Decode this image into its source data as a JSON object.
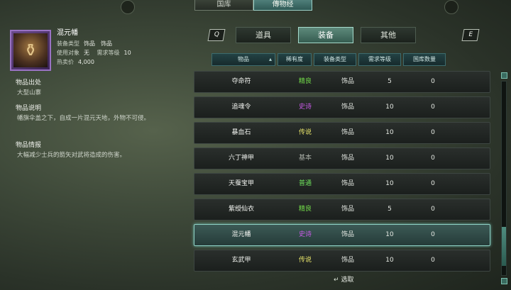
{
  "top_tabs": [
    {
      "label": "国库",
      "active": false
    },
    {
      "label": "傳物经",
      "active": true
    }
  ],
  "selected_item": {
    "name": "混元幡",
    "icon": "banner-relic-icon",
    "equip_type_label": "装备类型",
    "equip_type_value": "饰品",
    "equip_type_value2": "饰品",
    "target_label": "使用对象",
    "target_value": "无",
    "req_level_label": "需求等级",
    "req_level_value": "10",
    "price_label": "热卖价",
    "price_value": "4,000"
  },
  "sections": [
    {
      "title": "物品出处",
      "body": "大型山寨"
    },
    {
      "title": "物品说明",
      "body": "幡旗伞盖之下，自成一片混元天地，外物不可侵。"
    },
    {
      "title": "物品情报",
      "body": "大幅减少士兵的箭矢对武将造成的伤害。"
    }
  ],
  "category_tabs": [
    {
      "label": "道具",
      "active": false
    },
    {
      "label": "装备",
      "active": true
    },
    {
      "label": "其他",
      "active": false
    }
  ],
  "keys": {
    "left": "Q",
    "right": "E"
  },
  "headers": [
    "物品",
    "稀有度",
    "装备类型",
    "需求等级",
    "国库数量"
  ],
  "rows": [
    {
      "name": "夺命符",
      "rarity": "精良",
      "rarity_color": "#74e04a",
      "type": "饰品",
      "level": "5",
      "count": "0"
    },
    {
      "name": "追魂令",
      "rarity": "史诗",
      "rarity_color": "#c95ae8",
      "type": "饰品",
      "level": "10",
      "count": "0"
    },
    {
      "name": "暴血石",
      "rarity": "传说",
      "rarity_color": "#e8e46a",
      "type": "饰品",
      "level": "10",
      "count": "0"
    },
    {
      "name": "六丁神甲",
      "rarity": "基本",
      "rarity_color": "#a9aea6",
      "type": "饰品",
      "level": "10",
      "count": "0"
    },
    {
      "name": "天蚕宝甲",
      "rarity": "普通",
      "rarity_color": "#6fe35c",
      "type": "饰品",
      "level": "10",
      "count": "0"
    },
    {
      "name": "紫绶仙衣",
      "rarity": "精良",
      "rarity_color": "#74e04a",
      "type": "饰品",
      "level": "5",
      "count": "0"
    },
    {
      "name": "混元幡",
      "rarity": "史诗",
      "rarity_color": "#c95ae8",
      "type": "饰品",
      "level": "10",
      "count": "0",
      "selected": true
    },
    {
      "name": "玄武甲",
      "rarity": "传说",
      "rarity_color": "#e8e46a",
      "type": "饰品",
      "level": "10",
      "count": "0"
    }
  ],
  "footer": {
    "action_label": "选取",
    "icon": "enter-key-icon"
  }
}
